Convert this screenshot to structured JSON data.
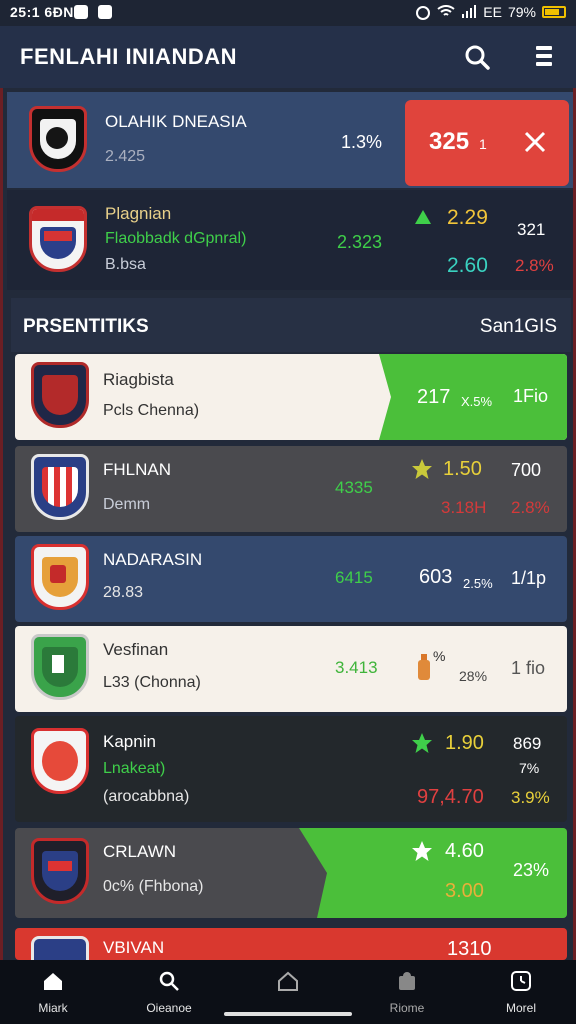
{
  "status_bar": {
    "time": "25:1 6ÐN",
    "signal": "EE",
    "battery": "79%"
  },
  "header": {
    "title": "FENLAHI INIANDAN",
    "search_icon": "search-icon",
    "menu_icon": "menu-icon"
  },
  "featured": {
    "team": "OLAHIK DNEASIA",
    "sub": "2.425",
    "percent": "1.3%",
    "alert_value": "325",
    "alert_unit": "1",
    "close_icon": "close-icon",
    "accent": "#e0443c"
  },
  "featured2": {
    "team": "Plagnian",
    "sub_green": "Flaobbadk dGpnral)",
    "sub": "B.bsa",
    "mid_value": "2.323",
    "value_top": "2.29",
    "value_bottom": "2.60",
    "right_top": "321",
    "right_bottom": "2.8%"
  },
  "section": {
    "left": "PRSENTITIKS",
    "right": "San1GIS"
  },
  "rows": [
    {
      "team": "Riagbista",
      "sub": "Pcls Chenna)",
      "mid": "",
      "value": "217",
      "pct": "X.5%",
      "right": "1Fio"
    },
    {
      "team": "FHLNAN",
      "sub": "Demm",
      "mid": "4335",
      "value": "1.50",
      "pct": "3.18H",
      "right": "700",
      "right2": "2.8%"
    },
    {
      "team": "NADARASIN",
      "sub": "28.83",
      "mid": "6415",
      "value": "603",
      "pct": "2.5%",
      "right": "1/1p"
    },
    {
      "team": "Vesfinan",
      "sub": "L33 (Chonna)",
      "mid": "3.413",
      "value": "%",
      "pct": "28%",
      "right": "1 fio"
    },
    {
      "team": "Kapnin",
      "sub_green": "Lnakeat)",
      "sub": "(arocabbna)",
      "mid": "",
      "value": "1.90",
      "pct": "97,4.70",
      "right": "869",
      "right_mid": "7%",
      "right2": "3.9%"
    },
    {
      "team": "CRLAWN",
      "sub": "0c% (Fhbona)",
      "mid": "",
      "value": "4.60",
      "pct": "3.00",
      "right": "23%"
    },
    {
      "team": "VBIVAN",
      "value": "1310"
    }
  ],
  "nav": [
    {
      "label": "Miark",
      "icon": "home-icon"
    },
    {
      "label": "Oieanoe",
      "icon": "search-icon"
    },
    {
      "label": "",
      "icon": "house-icon"
    },
    {
      "label": "Riome",
      "icon": "profile-icon"
    },
    {
      "label": "Morel",
      "icon": "clock-icon"
    }
  ]
}
